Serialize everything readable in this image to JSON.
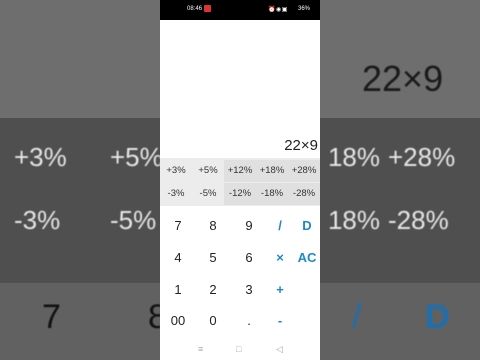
{
  "background": {
    "expression": "22×9",
    "pct_row1": [
      "+3%",
      "+5%",
      "18%",
      "+28%"
    ],
    "pct_row2": [
      "-3%",
      "-5%",
      "18%",
      "-28%"
    ],
    "keys": [
      "7",
      "8",
      "/",
      "D"
    ]
  },
  "status_bar": {
    "time": "08:46",
    "battery": "36%"
  },
  "display": {
    "expression": "22×9"
  },
  "percent_buttons": {
    "row1": [
      "+3%",
      "+5%",
      "+12%",
      "+18%",
      "+28%"
    ],
    "row2": [
      "-3%",
      "-5%",
      "-12%",
      "-18%",
      "-28%"
    ]
  },
  "keypad": {
    "k7": "7",
    "k8": "8",
    "k9": "9",
    "divide": "/",
    "delete": "D",
    "k4": "4",
    "k5": "5",
    "k6": "6",
    "multiply": "×",
    "clear": "AC",
    "k1": "1",
    "k2": "2",
    "k3": "3",
    "plus": "+",
    "k00": "00",
    "k0": "0",
    "dot": ".",
    "minus": "-"
  },
  "navigation": {
    "menu": "≡",
    "home": "□",
    "back": "◁"
  },
  "colors": {
    "operator": "#1e88c8",
    "percent_bg": "#ececec"
  }
}
